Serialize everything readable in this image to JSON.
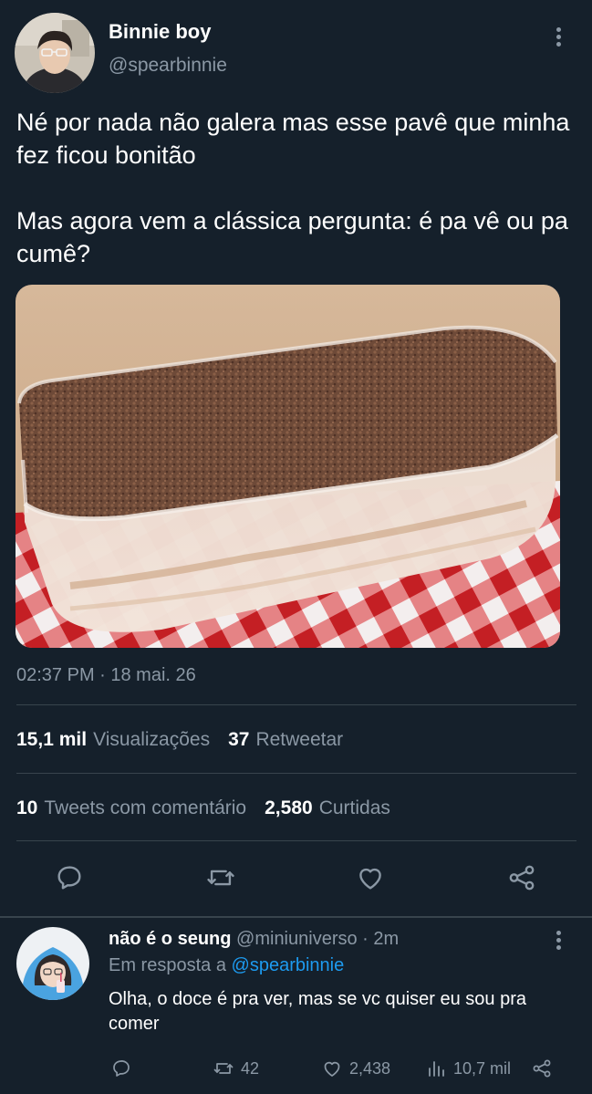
{
  "tweet": {
    "author_name": "Binnie boy",
    "author_handle": "@spearbinnie",
    "text": "Né por nada não galera mas esse pavê que minha fez ficou bonitão\n\nMas agora vem a clássica pergunta: é pa vê ou pa cumê?",
    "timestamp": "02:37 PM · 18 mai. 26",
    "stats": {
      "views_count": "15,1 mil",
      "views_label": "Visualizações",
      "retweets_count": "37",
      "retweets_label": "Retweetar",
      "quotes_count": "10",
      "quotes_label": "Tweets com comentário",
      "likes_count": "2,580",
      "likes_label": "Curtidas"
    },
    "actions": [
      "reply-icon",
      "retweet-icon",
      "like-icon",
      "share-icon"
    ]
  },
  "reply": {
    "author_name": "não é o seung",
    "author_handle": "@miniuniverso",
    "time": "· 2m",
    "reply_to_label": "Em resposta a",
    "reply_to_handle": "@spearbinnie",
    "text": "Olha, o doce é pra ver, mas se vc quiser eu sou pra comer",
    "retweets": "42",
    "likes": "2,438",
    "views": "10,7 mil"
  },
  "colors": {
    "background": "#15202b",
    "secondary_text": "#8b98a5",
    "divider": "#38444d",
    "link": "#1d9bf0"
  }
}
